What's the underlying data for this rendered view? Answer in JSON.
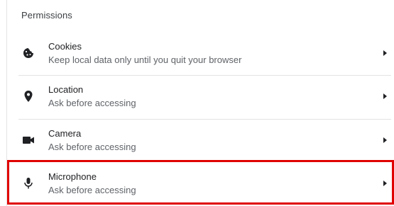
{
  "section": {
    "title": "Permissions"
  },
  "items": [
    {
      "icon": "cookie-icon",
      "label": "Cookies",
      "description": "Keep local data only until you quit your browser"
    },
    {
      "icon": "location-pin-icon",
      "label": "Location",
      "description": "Ask before accessing"
    },
    {
      "icon": "camera-icon",
      "label": "Camera",
      "description": "Ask before accessing"
    },
    {
      "icon": "microphone-icon",
      "label": "Microphone",
      "description": "Ask before accessing",
      "highlighted": true
    }
  ],
  "colors": {
    "highlight_border": "#e00000",
    "text_primary": "#202124",
    "text_secondary": "#5f6368",
    "divider": "#e3e3e3"
  }
}
